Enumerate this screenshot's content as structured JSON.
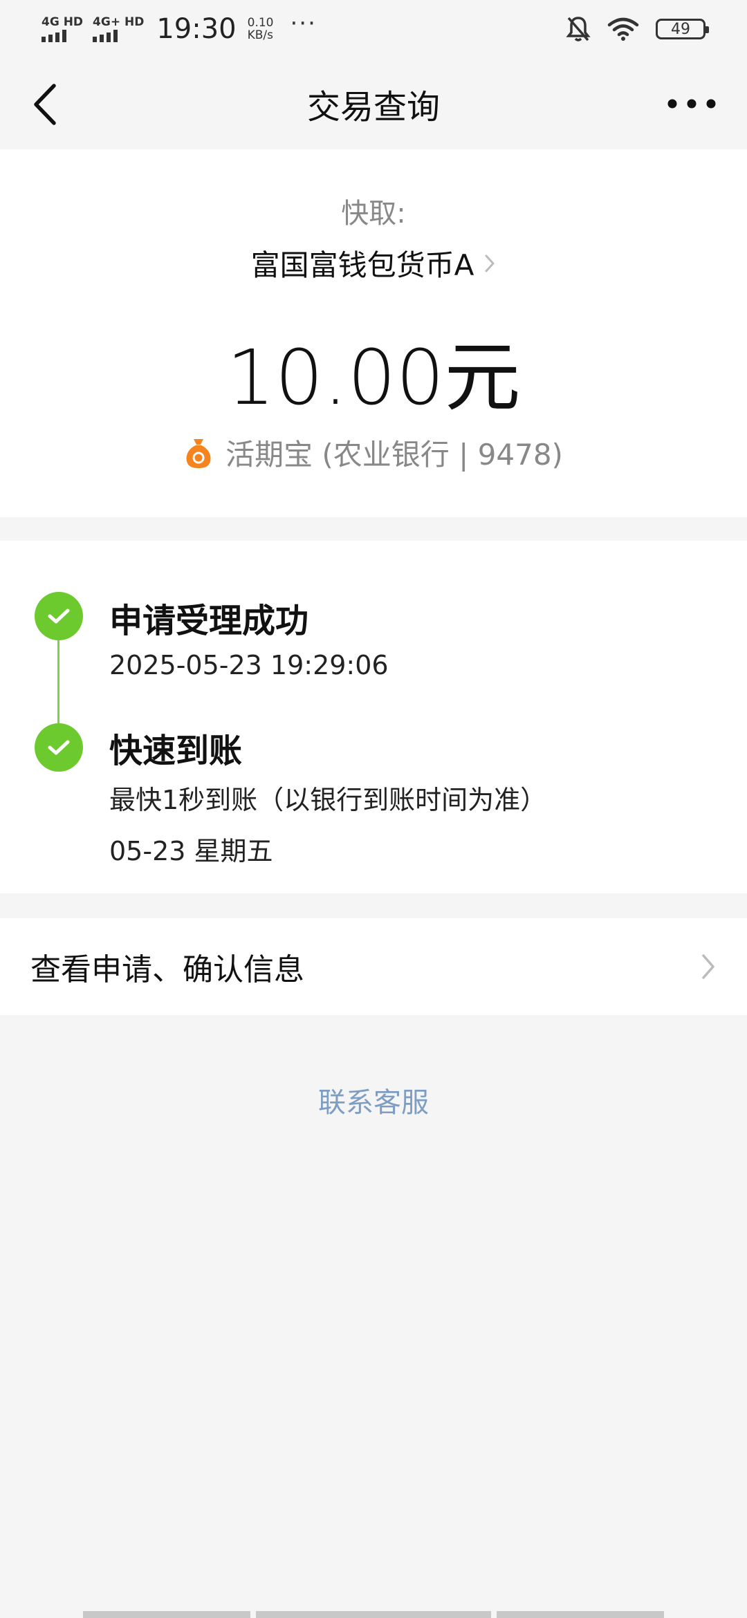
{
  "status_bar": {
    "sim1_label": "4G HD",
    "sim2_label": "4G+ HD",
    "time": "19:30",
    "net_speed_value": "0.10",
    "net_speed_unit": "KB/s",
    "more_dots": "···",
    "battery_level": "49"
  },
  "nav": {
    "title": "交易查询",
    "back_icon": "chevron-left-icon",
    "more_icon": "more-horizontal-icon"
  },
  "transaction": {
    "type_label": "快取:",
    "fund_name": "富国富钱包货币A",
    "amount": "10.00元",
    "account": "活期宝 (农业银行 | 9478)",
    "account_icon": "money-bag-icon"
  },
  "timeline": [
    {
      "title": "申请受理成功",
      "lines": [
        "2025-05-23 19:29:06"
      ]
    },
    {
      "title": "快速到账",
      "lines": [
        "最快1秒到账（以银行到账时间为准）",
        "05-23 星期五"
      ]
    }
  ],
  "info_row": {
    "label": "查看申请、确认信息"
  },
  "contact_link": "联系客服",
  "colors": {
    "success_green": "#6cc92e",
    "link_blue": "#7d9ec2",
    "icon_orange": "#f5841f",
    "page_bg": "#f5f5f5"
  }
}
